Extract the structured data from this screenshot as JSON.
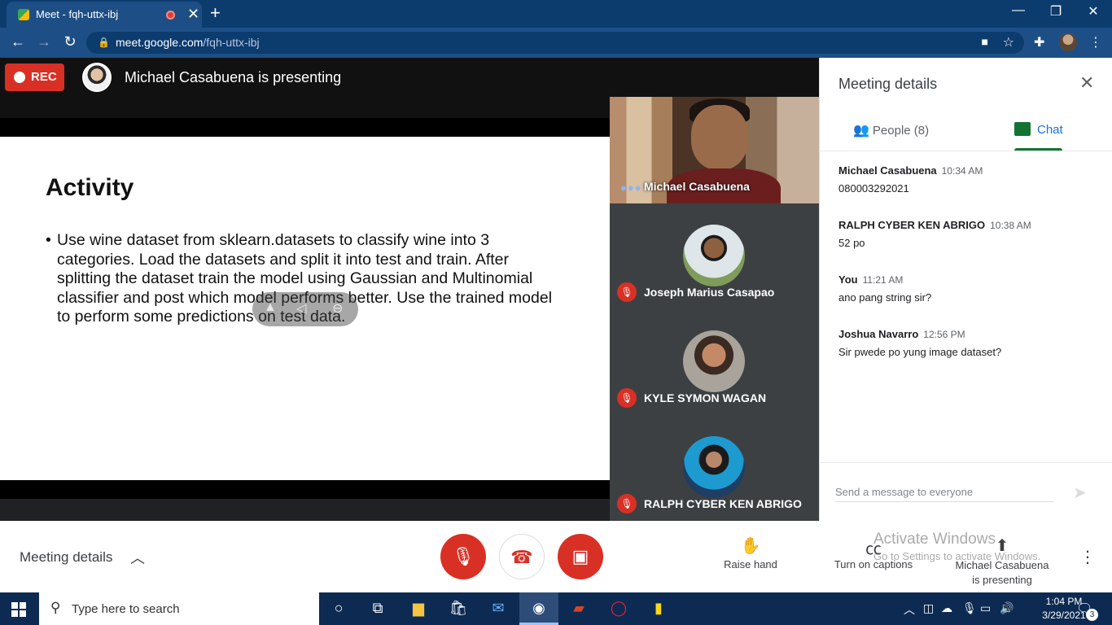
{
  "browser": {
    "tab_title": "Meet - fqh-uttx-ibj",
    "url_host": "meet.google.com",
    "url_path": "/fqh-uttx-ibj"
  },
  "meet": {
    "rec_label": "REC",
    "presenting_text": "Michael Casabuena is presenting",
    "slide": {
      "title": "Activity",
      "bullet": "Use wine dataset from sklearn.datasets to classify wine into 3 categories. Load the datasets and split it into test and train. After splitting the dataset train the model using Gaussian and Multinomial classifier and post which model performs better. Use the trained model to perform some predictions on test data."
    },
    "tiles": [
      {
        "name": "Michael Casabuena"
      },
      {
        "name": "Joseph Marius Casapao"
      },
      {
        "name": "KYLE SYMON WAGAN"
      },
      {
        "name": "RALPH CYBER KEN ABRIGO"
      }
    ]
  },
  "panel": {
    "title": "Meeting details",
    "tab_people": "People (8)",
    "tab_chat": "Chat",
    "messages": [
      {
        "sender": "Michael Casabuena",
        "time": "10:34 AM",
        "text": "080003292021"
      },
      {
        "sender": "RALPH CYBER KEN ABRIGO",
        "time": "10:38 AM",
        "text": "52 po"
      },
      {
        "sender": "You",
        "time": "11:21 AM",
        "text": "ano pang string sir?"
      },
      {
        "sender": "Joshua Navarro",
        "time": "12:56 PM",
        "text": "Sir pwede po yung image dataset?"
      }
    ],
    "compose_placeholder": "Send a message to everyone"
  },
  "bottom": {
    "meeting_details": "Meeting details",
    "raise_hand": "Raise hand",
    "captions": "Turn on captions",
    "present_line1": "Michael Casabuena",
    "present_line2": "is presenting"
  },
  "watermark": {
    "line1": "Activate Windows",
    "line2": "Go to Settings to activate Windows."
  },
  "taskbar": {
    "search_placeholder": "Type here to search",
    "time": "1:04 PM",
    "date": "3/29/2021",
    "notifications": "3"
  },
  "colors": {
    "accent_red": "#d93025",
    "chat_green": "#137333",
    "tab_blue": "#1a73e8"
  }
}
